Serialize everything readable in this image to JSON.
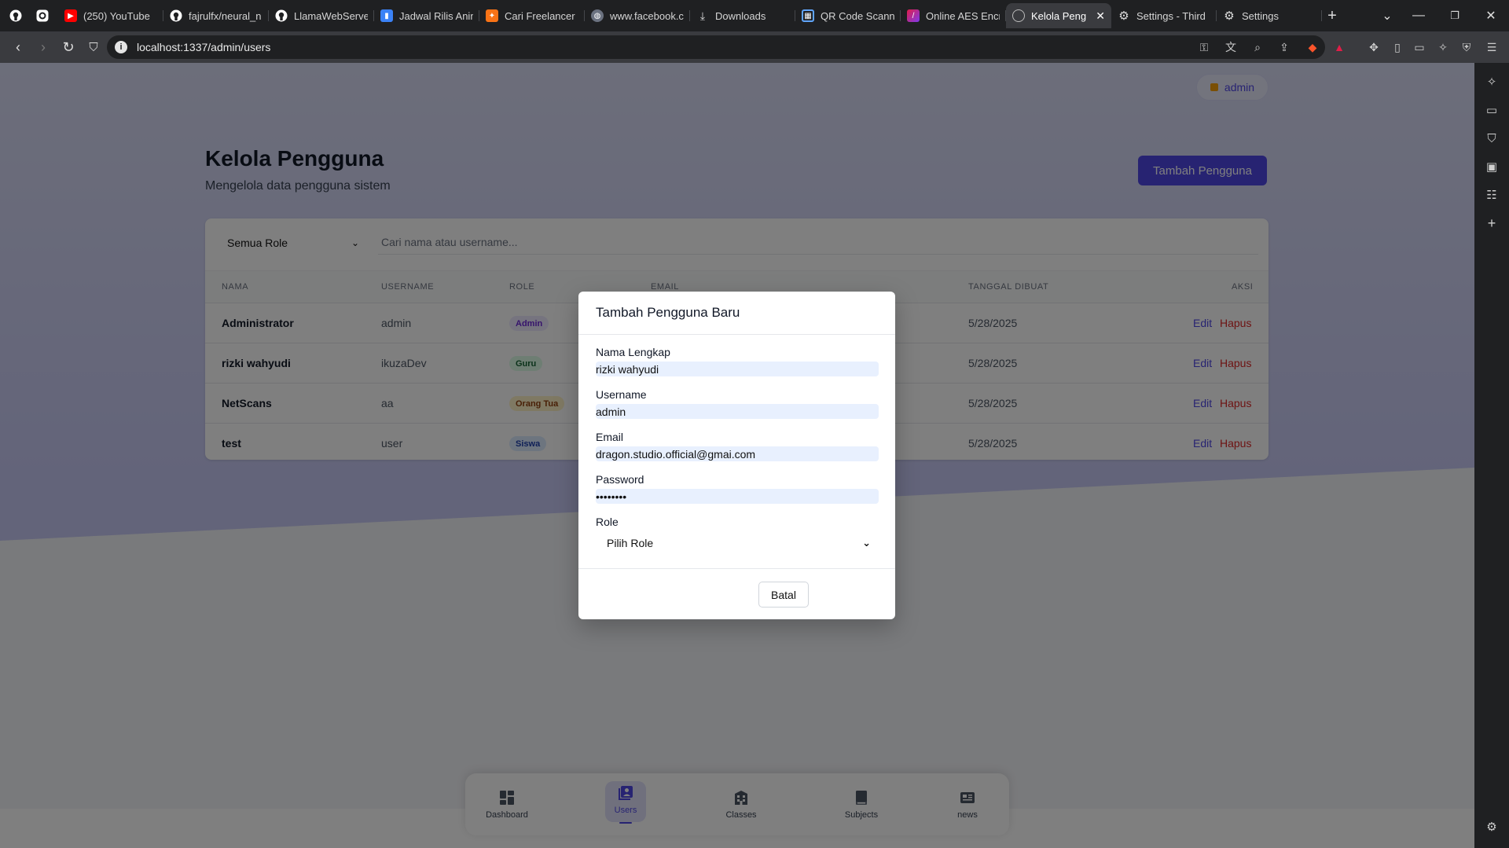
{
  "browser": {
    "tabs": [
      {
        "label": "(250) YouTube",
        "icon": "youtube-icon",
        "color": "#ff0000"
      },
      {
        "label": "fajrulfx/neural_n",
        "icon": "github-icon",
        "color": "#ffffff"
      },
      {
        "label": "LlamaWebServe",
        "icon": "github-icon",
        "color": "#ffffff"
      },
      {
        "label": "Jadwal Rilis Anim",
        "icon": "bookmark-icon",
        "color": "#3b82f6"
      },
      {
        "label": "Cari Freelancer I",
        "icon": "freelancer-icon",
        "color": "#f97316"
      },
      {
        "label": "www.facebook.c",
        "icon": "globe-icon",
        "color": "#9ca3af"
      },
      {
        "label": "Downloads",
        "icon": "download-icon",
        "color": "#d1d5db"
      },
      {
        "label": "QR Code Scann",
        "icon": "qr-icon",
        "color": "#60a5fa"
      },
      {
        "label": "Online AES Encr",
        "icon": "aes-icon",
        "color": "#e11d48"
      },
      {
        "label": "Kelola Peng",
        "icon": "globe-icon",
        "color": "#9ca3af",
        "active": true
      },
      {
        "label": "Settings - Third",
        "icon": "gear-icon",
        "color": "#d1d5db"
      },
      {
        "label": "Settings",
        "icon": "gear-icon",
        "color": "#d1d5db"
      }
    ],
    "url": "localhost:1337/admin/users"
  },
  "header": {
    "user_label": "admin",
    "title": "Kelola Pengguna",
    "subtitle": "Mengelola data pengguna sistem",
    "add_button": "Tambah Pengguna"
  },
  "filters": {
    "role_select": "Semua Role",
    "search_placeholder": "Cari nama atau username..."
  },
  "table": {
    "headers": {
      "name": "Nama",
      "username": "Username",
      "role": "Role",
      "email": "Email",
      "created": "Tanggal Dibuat",
      "actions": "Aksi"
    },
    "rows": [
      {
        "name": "Administrator",
        "username": "admin",
        "role": "Admin",
        "role_bg": "#ede9fe",
        "role_fg": "#6d28d9",
        "created": "5/28/2025",
        "edit": "Edit",
        "delete": "Hapus"
      },
      {
        "name": "rizki wahyudi",
        "username": "ikuzaDev",
        "role": "Guru",
        "role_bg": "#dcfce7",
        "role_fg": "#166534",
        "created": "5/28/2025",
        "edit": "Edit",
        "delete": "Hapus"
      },
      {
        "name": "NetScans",
        "username": "aa",
        "role": "Orang Tua",
        "role_bg": "#fef3c7",
        "role_fg": "#92400e",
        "created": "5/28/2025",
        "edit": "Edit",
        "delete": "Hapus"
      },
      {
        "name": "test",
        "username": "user",
        "role": "Siswa",
        "role_bg": "#dbeafe",
        "role_fg": "#1e40af",
        "created": "5/28/2025",
        "edit": "Edit",
        "delete": "Hapus"
      }
    ]
  },
  "modal": {
    "title": "Tambah Pengguna Baru",
    "fields": {
      "name_label": "Nama Lengkap",
      "name_value": "rizki wahyudi",
      "username_label": "Username",
      "username_value": "admin",
      "email_label": "Email",
      "email_value": "dragon.studio.official@gmai.com",
      "password_label": "Password",
      "password_value": "••••••••",
      "role_label": "Role",
      "role_value": "Pilih Role"
    },
    "cancel_button": "Batal"
  },
  "bottom_nav": {
    "items": [
      {
        "label": "Dashboard",
        "icon": "dashboard-icon"
      },
      {
        "label": "Users",
        "icon": "users-icon",
        "active": true
      },
      {
        "label": "Classes",
        "icon": "building-icon"
      },
      {
        "label": "Subjects",
        "icon": "book-icon"
      },
      {
        "label": "news",
        "icon": "newspaper-icon"
      }
    ]
  },
  "colors": {
    "accent": "#4f46e5",
    "danger": "#dc2626"
  }
}
